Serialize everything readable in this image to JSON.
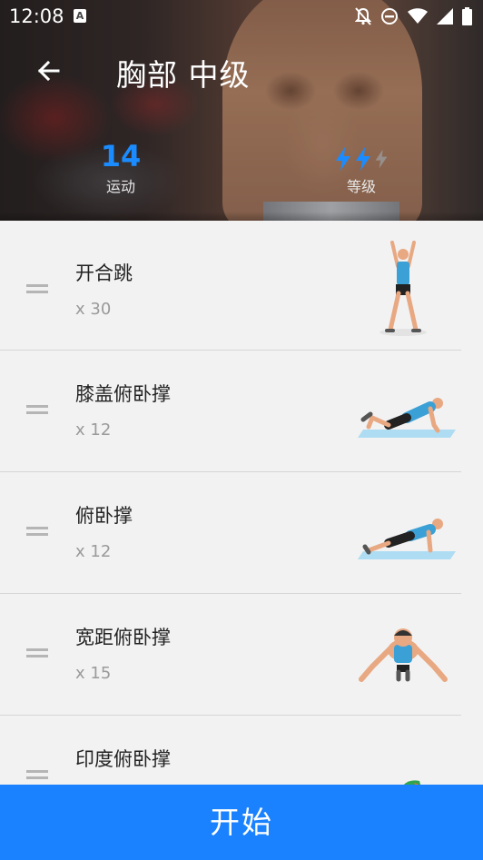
{
  "status_bar": {
    "time": "12:08",
    "notification_badge": "A"
  },
  "header": {
    "title": "胸部 中级",
    "exercises_count": "14",
    "exercises_label": "运动",
    "level_label": "等级",
    "level_bolts_filled": 2,
    "level_bolts_total": 3,
    "accent_color": "#1a8cff"
  },
  "exercises": [
    {
      "name": "开合跳",
      "reps": "x 30",
      "icon": "jumping-jacks-figure"
    },
    {
      "name": "膝盖俯卧撑",
      "reps": "x 12",
      "icon": "knee-pushup-figure"
    },
    {
      "name": "俯卧撑",
      "reps": "x 12",
      "icon": "pushup-figure"
    },
    {
      "name": "宽距俯卧撑",
      "reps": "x 15",
      "icon": "wide-pushup-figure"
    },
    {
      "name": "印度俯卧撑",
      "reps": "",
      "icon": "hindu-pushup-figure"
    }
  ],
  "start_button": {
    "label": "开始",
    "color": "#1a82ff"
  }
}
